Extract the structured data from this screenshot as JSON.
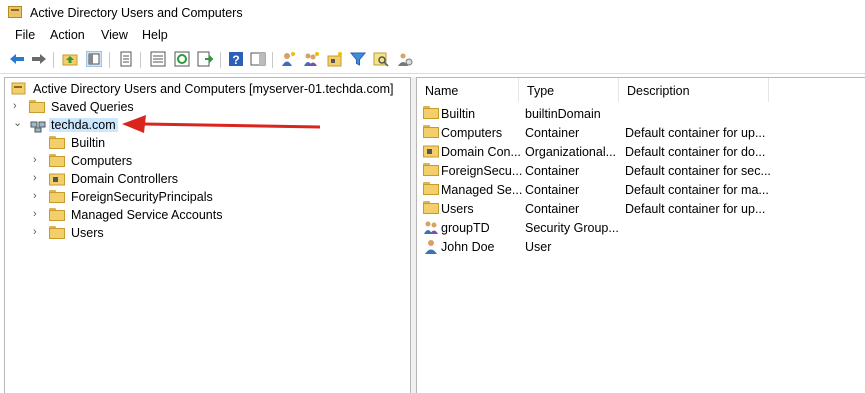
{
  "window": {
    "title": "Active Directory Users and Computers"
  },
  "menu": [
    "File",
    "Action",
    "View",
    "Help"
  ],
  "toolbar": {
    "icons": [
      "back-icon",
      "forward-icon",
      "up-folder-icon",
      "console-tree-icon",
      "properties-icon",
      "list-icon",
      "refresh-icon",
      "export-icon",
      "help-icon",
      "action-pane-icon",
      "new-user-icon",
      "new-group-icon",
      "new-ou-icon",
      "filter-icon",
      "find-icon",
      "delegate-icon"
    ]
  },
  "tree": {
    "root": "Active Directory Users and Computers [myserver-01.techda.com]",
    "saved_queries": "Saved Queries",
    "domain": "techda.com",
    "children": [
      "Builtin",
      "Computers",
      "Domain Controllers",
      "ForeignSecurityPrincipals",
      "Managed Service Accounts",
      "Users"
    ]
  },
  "list": {
    "columns": [
      "Name",
      "Type",
      "Description"
    ],
    "rows": [
      {
        "name": "Builtin",
        "type": "builtinDomain",
        "description": "",
        "icon": "folder-icon"
      },
      {
        "name": "Computers",
        "type": "Container",
        "description": "Default container for up...",
        "icon": "folder-icon"
      },
      {
        "name": "Domain Con...",
        "type": "Organizational...",
        "description": "Default container for do...",
        "icon": "ou-folder-icon"
      },
      {
        "name": "ForeignSecu...",
        "type": "Container",
        "description": "Default container for sec...",
        "icon": "folder-icon"
      },
      {
        "name": "Managed Se...",
        "type": "Container",
        "description": "Default container for ma...",
        "icon": "folder-icon"
      },
      {
        "name": "Users",
        "type": "Container",
        "description": "Default container for up...",
        "icon": "folder-icon"
      },
      {
        "name": "groupTD",
        "type": "Security Group...",
        "description": "",
        "icon": "group-icon"
      },
      {
        "name": "John Doe",
        "type": "User",
        "description": "",
        "icon": "user-icon"
      }
    ]
  },
  "colors": {
    "selection": "#cce8ff",
    "annotation_arrow": "#d9251d",
    "folder": "#f3cf6b"
  }
}
